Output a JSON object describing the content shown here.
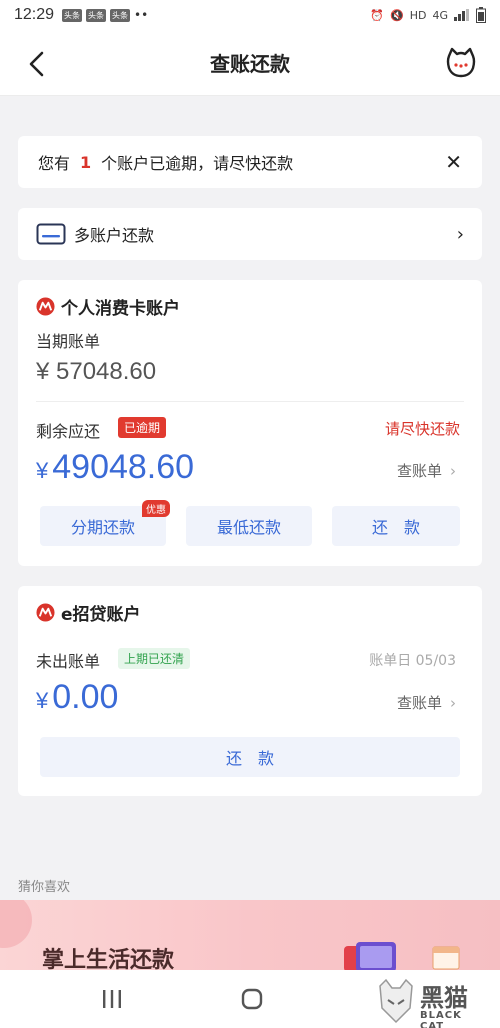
{
  "status": {
    "time": "12:29",
    "notifications": [
      "头条",
      "头条",
      "头条"
    ],
    "dots": "••",
    "network": "HD",
    "net_type": "4G"
  },
  "nav": {
    "title": "查账还款"
  },
  "alert": {
    "prefix": "您有",
    "count": "1",
    "suffix": "个账户已逾期，请尽快还款"
  },
  "multi_account": {
    "label": "多账户还款"
  },
  "account1": {
    "name": "个人消费卡账户",
    "current_bill_label": "当期账单",
    "current_bill_amount": "¥ 57048.60",
    "remaining_label": "剩余应还",
    "overdue_badge": "已逾期",
    "urge_text": "请尽快还款",
    "yen": "¥",
    "remaining_amount": "49048.60",
    "view_bill": "查账单",
    "buttons": {
      "installment": "分期还款",
      "installment_tag": "优惠",
      "minimum": "最低还款",
      "repay": "还　款"
    }
  },
  "account2": {
    "name": "e招贷账户",
    "unbilled_label": "未出账单",
    "cleared_badge": "上期已还清",
    "bill_day": "账单日 05/03",
    "yen": "¥",
    "amount": "0.00",
    "view_bill": "查账单",
    "repay": "还　款"
  },
  "recommend": {
    "title": "猜你喜欢"
  },
  "banner": {
    "title": "掌上生活还款"
  },
  "watermark": {
    "cn": "黑猫",
    "en": "BLACK CAT"
  },
  "colors": {
    "accent_blue": "#3a6ad6",
    "alert_red": "#d9342b",
    "success_green": "#33a34f"
  }
}
